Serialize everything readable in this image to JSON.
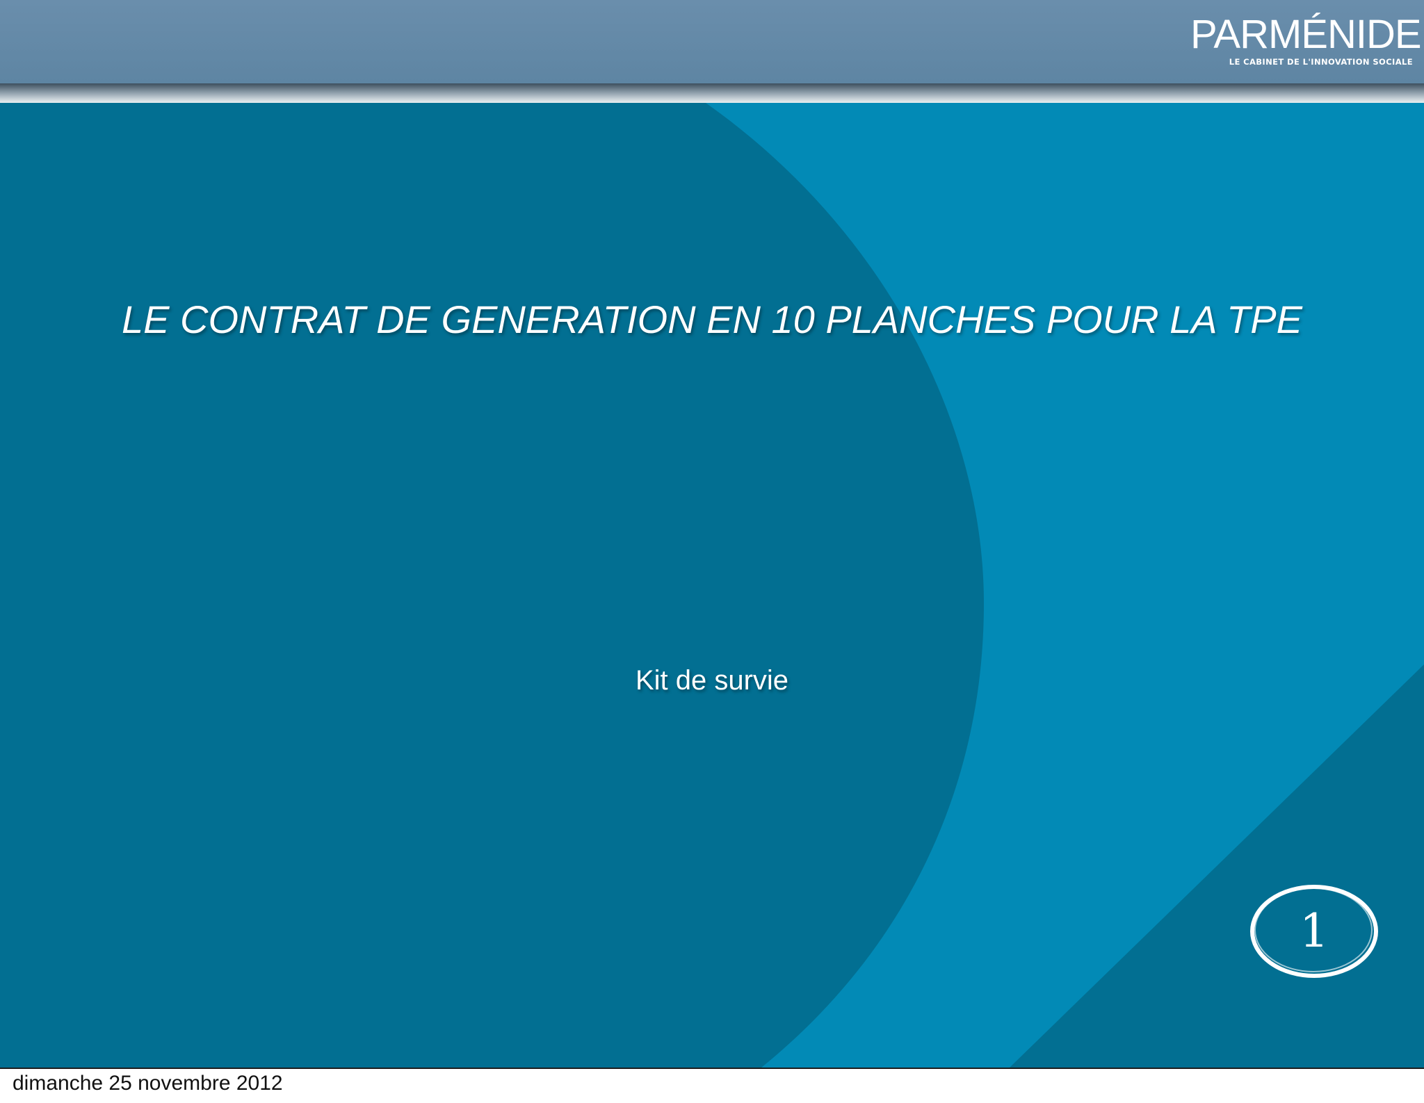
{
  "slide": {
    "logo": {
      "wordmark": "PARMÉNIDE",
      "tagline": "LE CABINET DE L'INNOVATION SOCIALE"
    },
    "title": "LE CONTRAT DE GENERATION EN 10 PLANCHES POUR LA TPE",
    "subtitle": "Kit de survie",
    "page_number": "1"
  },
  "footer": {
    "date": "dimanche 25 novembre 2012"
  },
  "colors": {
    "header": "#6a8eac",
    "dark_shape": "#026f92",
    "light_background": "#028ab6",
    "text": "#ffffff"
  }
}
